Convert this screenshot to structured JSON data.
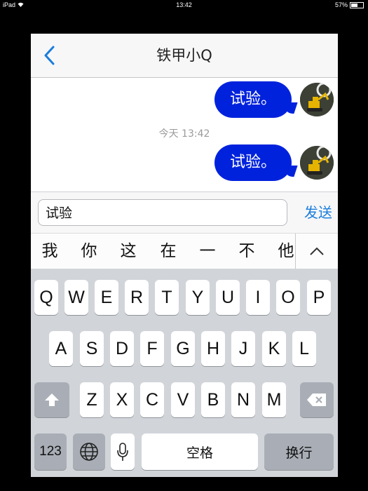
{
  "status_bar": {
    "device": "iPad",
    "time": "13:42",
    "battery": "57%",
    "battery_level": 0.57
  },
  "nav": {
    "title": "铁甲小Q"
  },
  "messages": [
    {
      "text": "试验。"
    },
    {
      "text": "试验。"
    }
  ],
  "timestamp": "今天 13:42",
  "composer": {
    "value": "试验",
    "send_label": "发送"
  },
  "candidates": [
    "我",
    "你",
    "这",
    "在",
    "一",
    "不",
    "他"
  ],
  "keyboard": {
    "row1": [
      "Q",
      "W",
      "E",
      "R",
      "T",
      "Y",
      "U",
      "I",
      "O",
      "P"
    ],
    "row2": [
      "A",
      "S",
      "D",
      "F",
      "G",
      "H",
      "J",
      "K",
      "L"
    ],
    "row3": [
      "Z",
      "X",
      "C",
      "V",
      "B",
      "N",
      "M"
    ],
    "numbers_label": "123",
    "space_label": "空格",
    "return_label": "换行"
  },
  "colors": {
    "bubble": "#0022dd",
    "link": "#1a7ddc"
  }
}
